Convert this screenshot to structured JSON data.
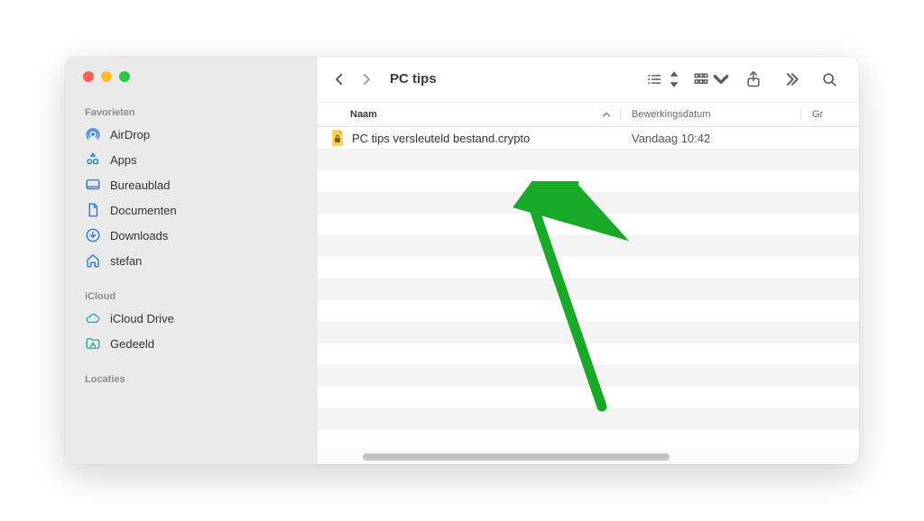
{
  "window_title": "PC tips",
  "sidebar": {
    "sections": [
      {
        "label": "Favorieten",
        "items": [
          {
            "name": "AirDrop"
          },
          {
            "name": "Apps"
          },
          {
            "name": "Bureaublad"
          },
          {
            "name": "Documenten"
          },
          {
            "name": "Downloads"
          },
          {
            "name": "stefan"
          }
        ]
      },
      {
        "label": "iCloud",
        "items": [
          {
            "name": "iCloud Drive"
          },
          {
            "name": "Gedeeld"
          }
        ]
      },
      {
        "label": "Locaties",
        "items": []
      }
    ]
  },
  "columns": {
    "name": "Naam",
    "date": "Bewerkingsdatum",
    "size": "Gr"
  },
  "files": [
    {
      "name": "PC tips versleuteld bestand.crypto",
      "date": "Vandaag 10:42"
    }
  ]
}
